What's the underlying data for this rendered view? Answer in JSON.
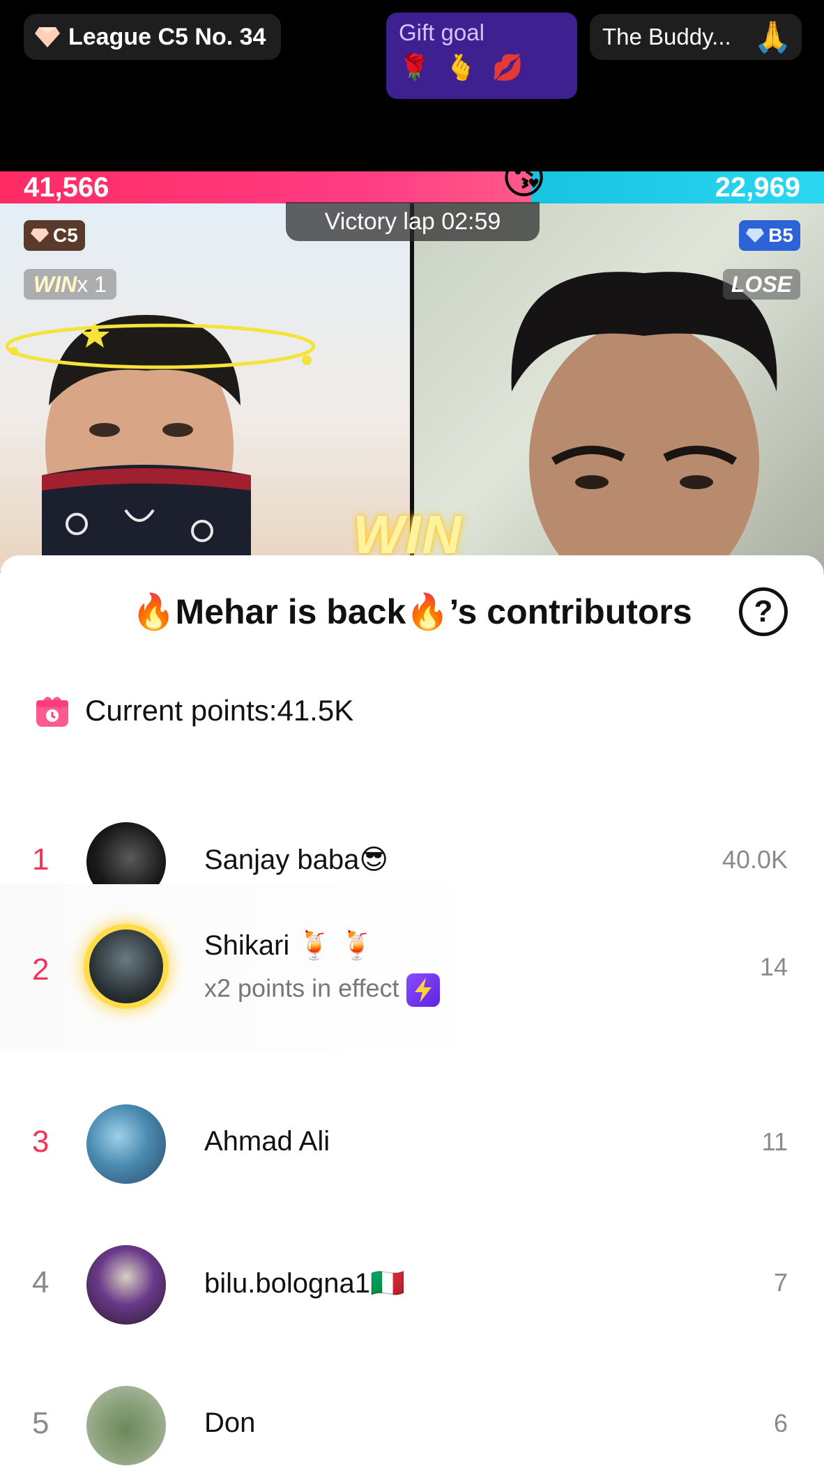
{
  "header": {
    "league": "League C5 No. 34",
    "gift_goal_title": "Gift goal",
    "gift_goal_icons": [
      "🌹",
      "🫰",
      "💋"
    ],
    "buddy_label": "The Buddy...",
    "buddy_icon": "🙏"
  },
  "battle": {
    "left_score": "41,566",
    "right_score": "22,969",
    "left_share": 0.644,
    "victory_lap": "Victory lap 02:59",
    "left_rank_badge": "C5",
    "right_rank_badge": "B5",
    "win_tag": "WIN",
    "win_multiplier": "x 1",
    "lose_tag": "LOSE",
    "win_banner": "WIN",
    "center_emoji": "😘",
    "colors": {
      "left": "#ff2b63",
      "right": "#18c3e0"
    }
  },
  "sheet": {
    "title": "🔥Mehar is back🔥’s contributors",
    "help_icon": "?",
    "points_label": "Current points:41.5K"
  },
  "contributors": [
    {
      "rank": "1",
      "name": "Sanjay baba😎",
      "sub": "",
      "score": "40.0K"
    },
    {
      "rank": "2",
      "name": "Shikari 🍹 🍹",
      "sub": "x2 points in effect",
      "score": "14"
    },
    {
      "rank": "3",
      "name": "Ahmad Ali",
      "sub": "",
      "score": "11"
    },
    {
      "rank": "4",
      "name": "bilu.bologna1🇮🇹",
      "sub": "",
      "score": "7"
    },
    {
      "rank": "5",
      "name": "Don",
      "sub": "",
      "score": "6"
    }
  ]
}
